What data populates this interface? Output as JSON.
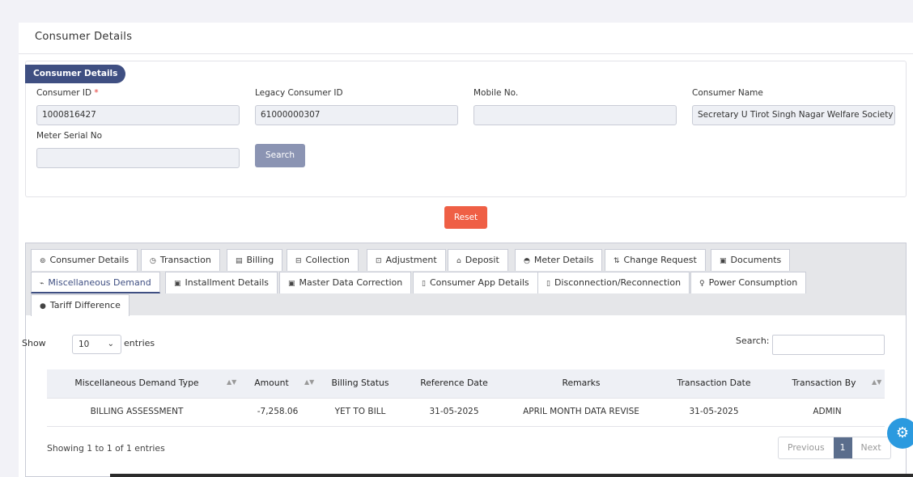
{
  "page": {
    "card_title": "Consumer Details"
  },
  "details": {
    "pill": "Consumer Details",
    "fields": {
      "consumer_id_label": "Consumer ID",
      "consumer_id_required": "*",
      "consumer_id_value": "1000816427",
      "legacy_id_label": "Legacy Consumer ID",
      "legacy_id_value": "61000000307",
      "mobile_label": "Mobile No.",
      "mobile_value": "",
      "name_label": "Consumer Name",
      "name_value": "Secretary U Tirot Singh Nagar Welfare Society",
      "meter_label": "Meter Serial No",
      "meter_value": ""
    },
    "search_button": "Search",
    "reset_button": "Reset"
  },
  "tabs": [
    {
      "label": "Consumer Details",
      "icon": "⊚"
    },
    {
      "label": "Transaction",
      "icon": "◷"
    },
    {
      "label": "Billing",
      "icon": "▤"
    },
    {
      "label": "Collection",
      "icon": "⊟"
    },
    {
      "label": "Adjustment",
      "icon": "⊡"
    },
    {
      "label": "Deposit",
      "icon": "⌂"
    },
    {
      "label": "Meter Details",
      "icon": "◓"
    },
    {
      "label": "Change Request",
      "icon": "⇅"
    },
    {
      "label": "Documents",
      "icon": "▣"
    },
    {
      "label": "Miscellaneous Demand",
      "icon": "⌁"
    },
    {
      "label": "Installment Details",
      "icon": "▣"
    },
    {
      "label": "Master Data Correction",
      "icon": "▣"
    },
    {
      "label": "Consumer App Details",
      "icon": "▯"
    },
    {
      "label": "Disconnection/Reconnection",
      "icon": "▯"
    },
    {
      "label": "Power Consumption",
      "icon": "♀"
    },
    {
      "label": "Tariff Difference",
      "icon": "●"
    }
  ],
  "table_controls": {
    "show": "Show",
    "entries_value": "10",
    "entries": "entries",
    "search_label": "Search:"
  },
  "table": {
    "headers": [
      "Miscellaneous Demand Type",
      "Amount",
      "Billing Status",
      "Reference Date",
      "Remarks",
      "Transaction Date",
      "Transaction By"
    ],
    "rows": [
      [
        "BILLING ASSESSMENT",
        "-7,258.06",
        "YET TO BILL",
        "31-05-2025",
        "APRIL MONTH DATA REVISE",
        "31-05-2025",
        "ADMIN"
      ]
    ]
  },
  "footer": {
    "showing": "Showing 1 to 1 of 1 entries",
    "previous": "Previous",
    "page": "1",
    "next": "Next"
  },
  "colors": {
    "primary": "#3f4f82",
    "reset": "#ef5f45",
    "search_button": "#8b94b3",
    "gear": "#2b9adf"
  }
}
